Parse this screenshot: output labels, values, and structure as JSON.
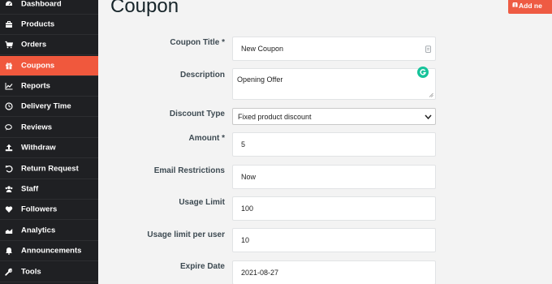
{
  "sidebar": {
    "items": [
      {
        "label": "Dashboard",
        "icon": "dashboard-icon"
      },
      {
        "label": "Products",
        "icon": "briefcase-icon"
      },
      {
        "label": "Orders",
        "icon": "cart-icon"
      },
      {
        "label": "Coupons",
        "icon": "gift-icon",
        "active": true
      },
      {
        "label": "Reports",
        "icon": "chart-line-icon"
      },
      {
        "label": "Delivery Time",
        "icon": "clock-icon"
      },
      {
        "label": "Reviews",
        "icon": "comments-icon"
      },
      {
        "label": "Withdraw",
        "icon": "upload-icon"
      },
      {
        "label": "Return Request",
        "icon": "undo-icon"
      },
      {
        "label": "Staff",
        "icon": "users-icon"
      },
      {
        "label": "Followers",
        "icon": "heart-icon"
      },
      {
        "label": "Analytics",
        "icon": "area-chart-icon"
      },
      {
        "label": "Announcements",
        "icon": "bell-icon"
      },
      {
        "label": "Tools",
        "icon": "wrench-icon"
      }
    ]
  },
  "header": {
    "title": "Coupon",
    "add_button_label": "Add ne"
  },
  "form": {
    "coupon_title": {
      "label": "Coupon Title *",
      "value": "New Coupon"
    },
    "description": {
      "label": "Description",
      "value": "Opening Offer"
    },
    "discount_type": {
      "label": "Discount Type",
      "value": "Fixed product discount"
    },
    "amount": {
      "label": "Amount *",
      "value": "5"
    },
    "email_restrictions": {
      "label": "Email Restrictions",
      "value": "Now"
    },
    "usage_limit": {
      "label": "Usage Limit",
      "value": "100"
    },
    "usage_limit_per_user": {
      "label": "Usage limit per user",
      "value": "10"
    },
    "expire_date": {
      "label": "Expire Date",
      "value": "2021-08-27"
    }
  },
  "colors": {
    "sidebar_bg": "#1f2023",
    "accent": "#f0583d",
    "grammarly": "#15c39a"
  }
}
